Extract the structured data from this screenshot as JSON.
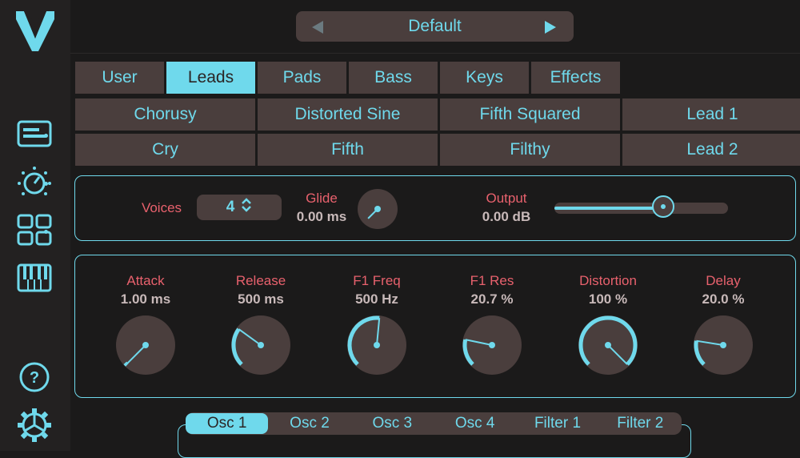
{
  "app": {
    "accent": "#6fd9ec",
    "label_color": "#e8616d",
    "tile_color": "#4a3e3d"
  },
  "sidebar": {
    "logo": "v-logo-icon",
    "items": [
      {
        "icon": "preset-card-icon"
      },
      {
        "icon": "dial-icon"
      },
      {
        "icon": "grid-icon"
      },
      {
        "icon": "piano-keys-icon"
      },
      {
        "icon": "help-icon"
      },
      {
        "icon": "gear-icon"
      }
    ]
  },
  "preset_bar": {
    "name": "Default",
    "prev_icon": "triangle-left-icon",
    "next_icon": "triangle-right-icon"
  },
  "categories": [
    "User",
    "Leads",
    "Pads",
    "Bass",
    "Keys",
    "Effects"
  ],
  "active_category": "Leads",
  "presets": [
    [
      "Chorusy",
      "Distorted Sine",
      "Fifth Squared",
      "Lead 1"
    ],
    [
      "Cry",
      "Fifth",
      "Filthy",
      "Lead 2"
    ]
  ],
  "global": {
    "voices_label": "Voices",
    "voices_value": "4",
    "glide_label": "Glide",
    "glide_value": "0.00 ms",
    "glide_level": 0.0,
    "output_label": "Output",
    "output_value": "0.00 dB",
    "output_level": 0.63
  },
  "knobs": [
    {
      "label": "Attack",
      "value": "1.00 ms",
      "level": 0.0
    },
    {
      "label": "Release",
      "value": "500 ms",
      "level": 0.3
    },
    {
      "label": "F1 Freq",
      "value": "500 Hz",
      "level": 0.52
    },
    {
      "label": "F1 Res",
      "value": "20.7 %",
      "level": 0.21
    },
    {
      "label": "Distortion",
      "value": "100 %",
      "level": 1.0
    },
    {
      "label": "Delay",
      "value": "20.0 %",
      "level": 0.2
    }
  ],
  "bottom_tabs": [
    "Osc 1",
    "Osc 2",
    "Osc 3",
    "Osc 4",
    "Filter 1",
    "Filter 2"
  ],
  "active_bottom_tab": "Osc 1"
}
